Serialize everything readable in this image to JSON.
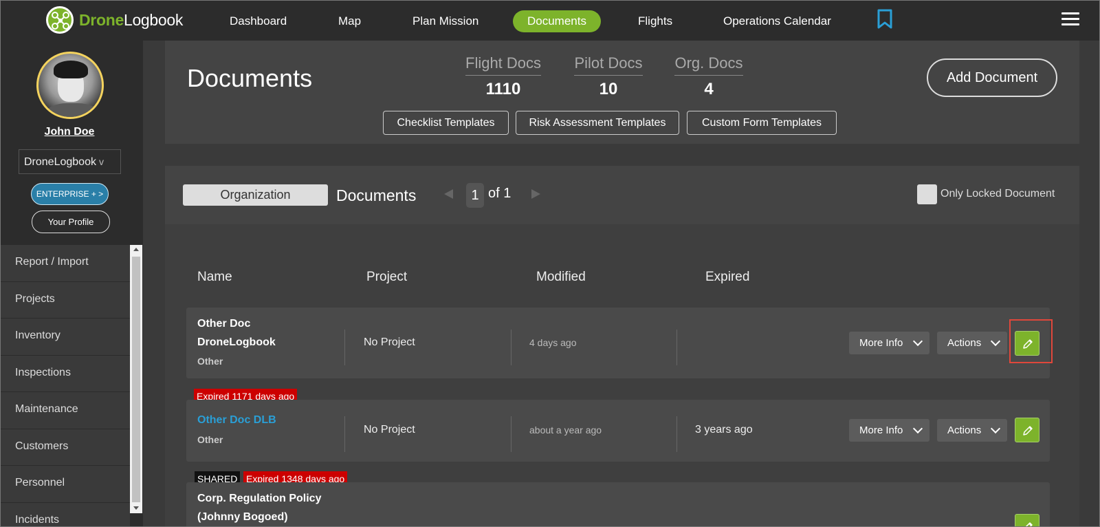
{
  "app": {
    "logo_part1": "Drone",
    "logo_part2": "Logbook"
  },
  "nav": {
    "items": [
      "Dashboard",
      "Map",
      "Plan Mission",
      "Documents",
      "Flights",
      "Operations Calendar"
    ],
    "active": "Documents"
  },
  "user": {
    "name": "John Doe",
    "org": "DroneLogbook",
    "org_chevron": "v",
    "plan_button": "ENTERPRISE + >",
    "profile_button": "Your Profile"
  },
  "sidebar": {
    "items": [
      "Report / Import",
      "Projects",
      "Inventory",
      "Inspections",
      "Maintenance",
      "Customers",
      "Personnel",
      "Incidents"
    ]
  },
  "header": {
    "title": "Documents",
    "stats": [
      {
        "label": "Flight Docs",
        "value": "1110"
      },
      {
        "label": "Pilot Docs",
        "value": "10"
      },
      {
        "label": "Org. Docs",
        "value": "4"
      }
    ],
    "template_buttons": [
      "Checklist Templates",
      "Risk Assessment Templates",
      "Custom Form Templates"
    ],
    "add_button": "Add Document"
  },
  "docs": {
    "scope_tab": "Organization",
    "label": "Documents",
    "page": "1",
    "of_text": "of 1",
    "locked_label": "Only Locked Document",
    "columns": [
      "Name",
      "Project",
      "Modified",
      "Expired"
    ],
    "rows": [
      {
        "name_line1": "Other Doc",
        "name_line2": "DroneLogbook",
        "type": "Other",
        "project": "No Project",
        "modified": "4 days ago",
        "expired": "",
        "more_info": "More Info",
        "actions": "Actions"
      },
      {
        "badge": "Expired 1171 days ago",
        "name_line1": "Other Doc DLB",
        "type": "Other",
        "project": "No Project",
        "modified": "about a year ago",
        "expired": "3 years ago",
        "more_info": "More Info",
        "actions": "Actions"
      },
      {
        "shared": "SHARED",
        "badge": "Expired 1348 days ago",
        "name_line1": "Corp. Regulation Policy",
        "name_line2": "(Johnny Bogoed)"
      }
    ]
  },
  "colors": {
    "accent": "#7db32b",
    "link": "#2a9fd6",
    "expired": "#cc0000",
    "highlight": "#e0473b"
  }
}
